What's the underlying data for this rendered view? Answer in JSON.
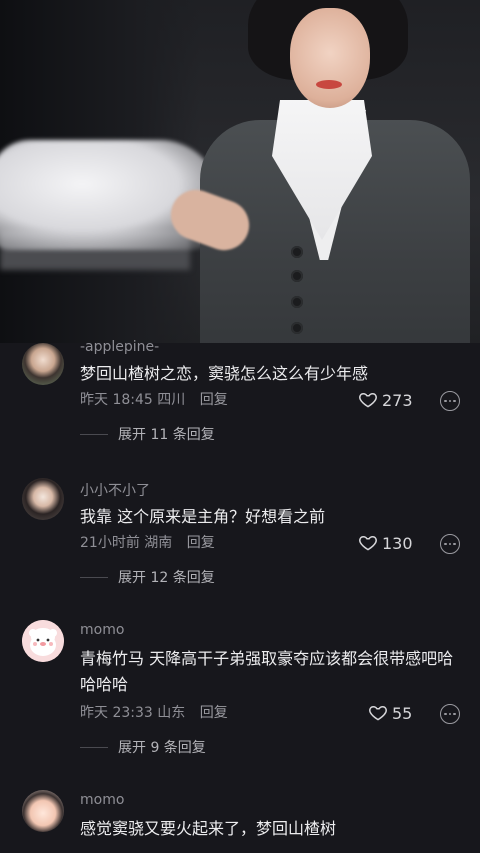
{
  "video": {
    "watermark": ""
  },
  "comments": [
    {
      "username": "-applepine-",
      "text": "梦回山楂树之恋，窦骁怎么这么有少年感",
      "time": "昨天 18:45",
      "location": "四川",
      "reply_label": "回复",
      "likes": "273",
      "expand_label": "展开 11 条回复",
      "avatar_icon": "user-avatar-photo"
    },
    {
      "username": "小小不小了",
      "text": "我靠 这个原来是主角？好想看之前",
      "time": "21小时前",
      "location": "湖南",
      "reply_label": "回复",
      "likes": "130",
      "expand_label": "展开 12 条回复",
      "avatar_icon": "user-avatar-photo"
    },
    {
      "username": "momo",
      "text": "青梅竹马 天降高干子弟强取豪夺应该都会很带感吧哈哈哈哈",
      "time": "昨天 23:33",
      "location": "山东",
      "reply_label": "回复",
      "likes": "55",
      "expand_label": "展开 9 条回复",
      "avatar_icon": "cartoon-bear-avatar"
    },
    {
      "username": "momo",
      "text": "感觉窦骁又要火起来了，梦回山楂树",
      "avatar_icon": "baby-photo-avatar"
    }
  ],
  "colors": {
    "background": "#17171c",
    "muted": "#8f8f96",
    "text": "#ececee"
  }
}
